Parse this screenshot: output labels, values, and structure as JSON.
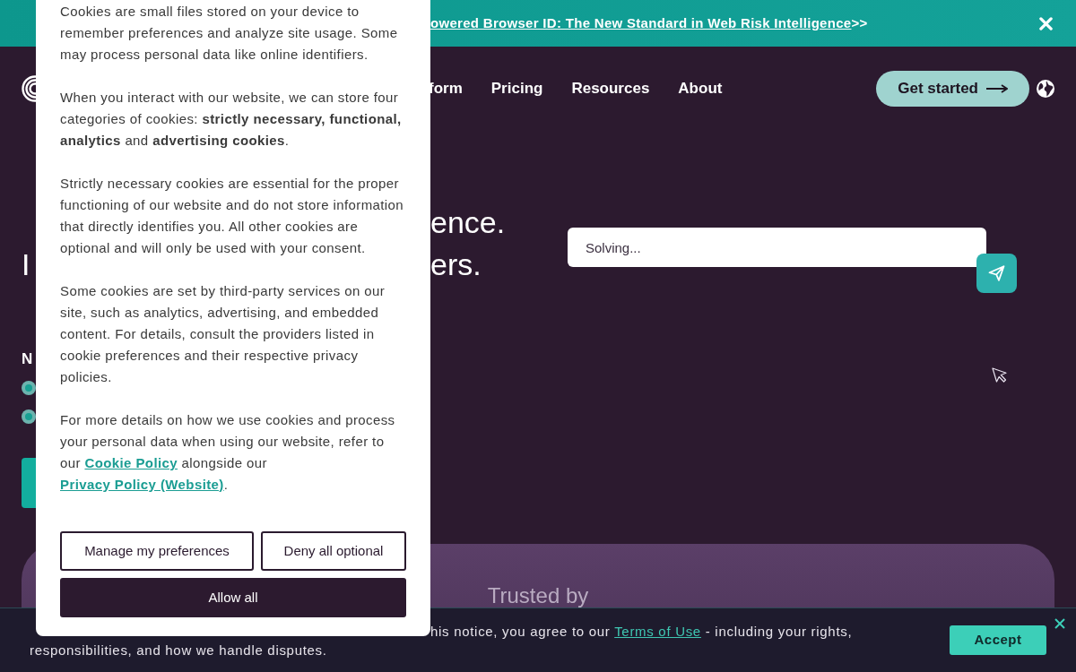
{
  "announcement": {
    "link": "owered Browser ID: The New Standard in Web Risk Intelligence",
    "suffix": ">>"
  },
  "nav": {
    "links": [
      "form",
      "Pricing",
      "Resources",
      "About"
    ],
    "cta": "Get started"
  },
  "hero": {
    "heading_lines": [
      {
        "right": "ence."
      },
      {
        "left": "I",
        "right": "ers."
      }
    ],
    "subheading": "N"
  },
  "prompt": {
    "value": "Solving..."
  },
  "panel": {
    "title": "Trusted by"
  },
  "cookie_dialog": {
    "paragraphs": [
      [
        {
          "kind": "text",
          "text": "Cookies are small files stored on your device to remember preferences and analyze site usage. Some may process personal data like online identifiers."
        }
      ],
      [
        {
          "kind": "text",
          "text": "When you interact with our website, we can store four categories of cookies: **strictly necessary, functional, analytics** and **advertising cookies**."
        }
      ],
      [
        {
          "kind": "text",
          "text": "Strictly necessary cookies are essential for the proper functioning of our website and do not store information that directly identifies you. All other cookies are optional and will only be used with your consent."
        }
      ],
      [
        {
          "kind": "text",
          "text": "Some cookies are set by third-party services on our site, such as analytics, advertising, and embedded content. For details, consult the providers listed in cookie preferences and their respective privacy policies."
        }
      ],
      [
        {
          "kind": "text",
          "text": "For more details on how we use cookies and process your personal data when using our website, refer to our "
        },
        {
          "kind": "link",
          "text": "Cookie Policy"
        },
        {
          "kind": "text",
          "text": " alongside our "
        },
        {
          "kind": "link",
          "text": "Privacy Policy (Website)"
        },
        {
          "kind": "text",
          "text": "."
        }
      ]
    ],
    "buttons": [
      {
        "label": "Manage my preferences",
        "kind": "outline"
      },
      {
        "label": "Deny all optional",
        "kind": "outline"
      },
      {
        "label": "Allow all",
        "kind": "primary"
      }
    ]
  },
  "consent_bar": {
    "line_1": [
      {
        "kind": "text",
        "text": "his notice, you agree to our "
      },
      {
        "kind": "link",
        "text": "Terms of Use"
      },
      {
        "kind": "text",
        "text": " - including your rights,"
      }
    ],
    "line_2": "responsibilities, and how we handle disputes.",
    "accept": "Accept"
  }
}
